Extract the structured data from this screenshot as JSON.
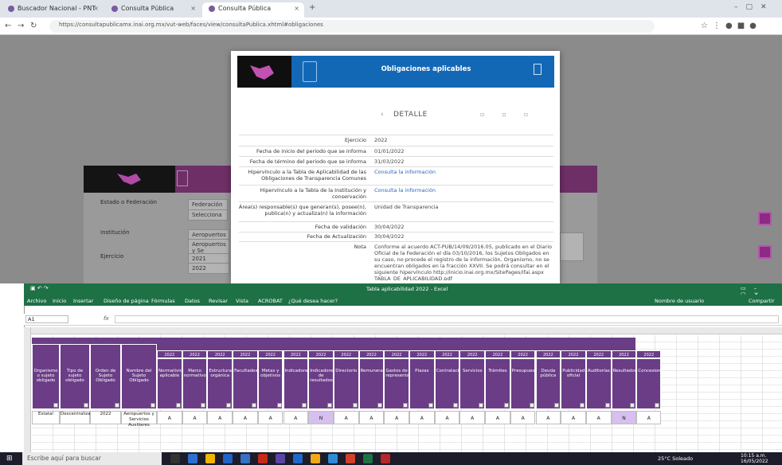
{
  "browser": {
    "tabs": [
      {
        "label": "Buscador Nacional - PNT"
      },
      {
        "label": "Consulta Pública"
      },
      {
        "label": "Consulta Pública"
      }
    ],
    "new_tab": "+",
    "url": "https://consultapublicamx.inai.org.mx/vut-web/faces/view/consultaPublica.xhtml#obligaciones"
  },
  "background_form": {
    "fields": [
      {
        "label": "Estado o Federación",
        "value1": "Federación",
        "value2": "Selecciona"
      },
      {
        "label": "Institución",
        "value1": "Aeropuertos y Se",
        "value2": "Aeropuertos y Se"
      },
      {
        "label": "Ejercicio",
        "value1": "2021",
        "value2": "2022"
      }
    ]
  },
  "modal": {
    "title": "Obligaciones aplicables",
    "detail_label": "DETALLE",
    "rows": [
      {
        "label": "Ejercicio",
        "value": "2022",
        "link": false
      },
      {
        "label": "Fecha de inicio del periodo que se informa",
        "value": "01/01/2022",
        "link": false
      },
      {
        "label": "Fecha de término del periodo que se informa",
        "value": "31/03/2022",
        "link": false
      },
      {
        "label": "Hipervínculo a la Tabla de Aplicabilidad de las Obligaciones de Transparencia Comunes",
        "value": "Consulta la información",
        "link": true
      },
      {
        "label": "Hipervínculo a la Tabla de la Institución y conservación",
        "value": "Consulta la información",
        "link": true
      },
      {
        "label": "Área(s) responsable(s) que generan(s), posee(n), publica(n) y actualiza(n) la información",
        "value": "Unidad de Transparencia",
        "link": false
      },
      {
        "label": "Fecha de validación",
        "value": "30/04/2022",
        "link": false
      },
      {
        "label": "Fecha de Actualización",
        "value": "30/04/2022",
        "link": false
      },
      {
        "label": "Nota",
        "value": "Conforme al acuerdo ACT-PUB/14/09/2016.05, publicado en el Diario Oficial de la Federación el día 03/10/2016, los Sujetos Obligados en su caso, no procede el registro de la información. Organismo, no se encuentran obligados en la fracción XXVII. Se podrá consultar en el siguiente hipervínculo http://inicio.inai.org.mx/SitePages/ifai.aspx TABLA_DE_APLICABILIDAD.pdf",
        "link": false
      }
    ]
  },
  "excel": {
    "title": "Tabla aplicabilidad 2022 - Excel",
    "ribbon": [
      "Archivo",
      "Inicio",
      "Insertar",
      "Diseño de página",
      "Fórmulas",
      "Datos",
      "Revisar",
      "Vista",
      "ACROBAT",
      "¿Qué desea hacer?"
    ],
    "share": "Compartir",
    "user": "Nombre de usuario",
    "name_box": "A1",
    "fx": "fx",
    "headers": [
      "Organismo o sujeto obligado",
      "Tipo de sujeto obligado",
      "Orden de Sujeto Obligado",
      "Nombre del Sujeto Obligado",
      "Normatividad aplicable",
      "Marco normativo",
      "Estructura orgánica",
      "Facultades",
      "Metas y objetivos",
      "Indicadores",
      "Indicadores de resultados",
      "Directorio",
      "Remuneración",
      "Gastos de representación",
      "Plazas",
      "Contrataciones",
      "Servicios",
      "Trámites",
      "Presupuesto",
      "Deuda pública",
      "Publicidad oficial",
      "Auditorías",
      "Resultados",
      "Concesiones"
    ],
    "year_headers": [
      "2022",
      "2022",
      "2022",
      "2022",
      "2022",
      "2022",
      "2022",
      "2022",
      "2022",
      "2022",
      "2022",
      "2022",
      "2022",
      "2022",
      "2022",
      "2022",
      "2022",
      "2022",
      "2022",
      "2022"
    ],
    "row_values": [
      "Estatal",
      "Descentralizado",
      "2022",
      "Aeropuertos y Servicios Auxiliares",
      "A",
      "A",
      "A",
      "A",
      "A",
      "A",
      "N",
      "A",
      "A",
      "A",
      "A",
      "A",
      "A",
      "A",
      "A",
      "A",
      "A",
      "A",
      "N",
      "A"
    ]
  },
  "taskbar": {
    "search_placeholder": "Escribe aquí para buscar",
    "weather": "25°C Soleado",
    "time": "10:15 a.m.",
    "date": "16/05/2022"
  },
  "colors": {
    "modal_header": "#1368b6",
    "purple": "#6a3d86",
    "excel_green": "#1e7145",
    "highlight": "#d7bff0"
  }
}
